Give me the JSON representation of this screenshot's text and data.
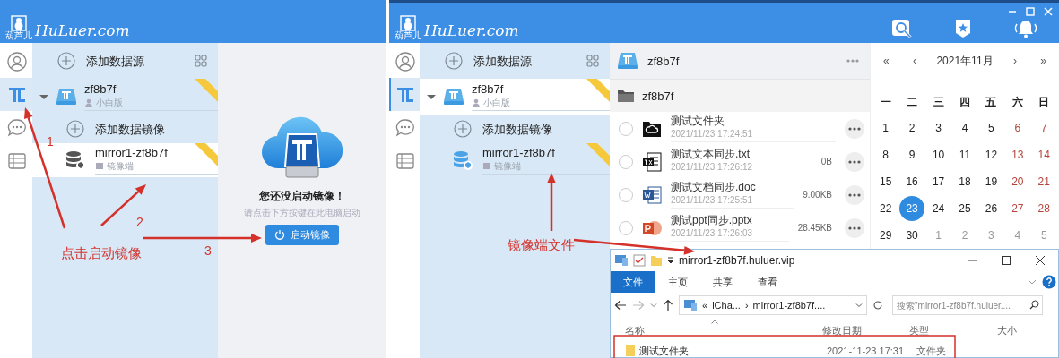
{
  "left_app": {
    "logo": {
      "text": "HuLuer.com",
      "caption": "葫芦儿"
    },
    "nav": [
      {
        "kind": "user",
        "selected": false
      },
      {
        "kind": "mirror",
        "selected": true
      },
      {
        "kind": "chat",
        "selected": false
      },
      {
        "kind": "list",
        "selected": false
      }
    ],
    "tree": {
      "add_label": "添加数据源",
      "sources": [
        {
          "name": "zf8b7f",
          "edition": "小白版",
          "expanded": true,
          "selected": false,
          "add_label": "添加数据镜像",
          "children": [
            {
              "name": "mirror1-zf8b7f",
              "role": "镜像端",
              "selected": true
            }
          ]
        }
      ]
    },
    "empty_state": {
      "title": "您还没启动镜像！",
      "hint": "请点击下方按键在此电脑启动",
      "button": "启动镜像"
    }
  },
  "right_app": {
    "logo": {
      "text": "HuLuer.com",
      "caption": "葫芦儿"
    },
    "header_icons": [
      {
        "kind": "search"
      },
      {
        "kind": "star"
      },
      {
        "kind": "bell"
      }
    ],
    "nav": [
      {
        "kind": "user",
        "selected": false
      },
      {
        "kind": "mirror",
        "selected": true
      },
      {
        "kind": "chat",
        "selected": false
      },
      {
        "kind": "list",
        "selected": false
      }
    ],
    "tree": {
      "add_label": "添加数据源",
      "sources": [
        {
          "name": "zf8b7f",
          "edition": "小白版",
          "expanded": true,
          "selected": true,
          "add_label": "添加数据镜像",
          "children": [
            {
              "name": "mirror1-zf8b7f",
              "role": "镜像端",
              "selected": false
            }
          ]
        }
      ]
    },
    "files": {
      "title": "zf8b7f",
      "folder": "zf8b7f",
      "items": [
        {
          "kind": "folder",
          "name": "测试文件夹",
          "date": "2021/11/23 17:24:51",
          "checked": false
        },
        {
          "kind": "txt",
          "name": "测试文本同步.txt",
          "date": "2021/11/23 17:26:12",
          "size": "0B",
          "checked": false
        },
        {
          "kind": "doc",
          "name": "测试文档同步.doc",
          "date": "2021/11/23 17:25:51",
          "size": "9.00KB",
          "checked": false
        },
        {
          "kind": "ppt",
          "name": "测试ppt同步.pptx",
          "date": "2021/11/23 17:26:03",
          "size": "28.45KB",
          "checked": false
        }
      ]
    },
    "calendar": {
      "nav": [
        "«",
        "‹",
        "›",
        "»"
      ],
      "title": "2021年11月",
      "weekdays": [
        "一",
        "二",
        "三",
        "四",
        "五",
        "六",
        "日"
      ],
      "weeks": [
        [
          {
            "day": "1",
            "kind": "weekday",
            "selected": false
          },
          {
            "day": "2",
            "kind": "weekday",
            "selected": false
          },
          {
            "day": "3",
            "kind": "weekday",
            "selected": false
          },
          {
            "day": "4",
            "kind": "weekday",
            "selected": false
          },
          {
            "day": "5",
            "kind": "weekday",
            "selected": false
          },
          {
            "day": "6",
            "kind": "weekend",
            "selected": false
          },
          {
            "day": "7",
            "kind": "weekend",
            "selected": false
          }
        ],
        [
          {
            "day": "8",
            "kind": "weekday",
            "selected": false
          },
          {
            "day": "9",
            "kind": "weekday",
            "selected": false
          },
          {
            "day": "10",
            "kind": "weekday",
            "selected": false
          },
          {
            "day": "11",
            "kind": "weekday",
            "selected": false
          },
          {
            "day": "12",
            "kind": "weekday",
            "selected": false
          },
          {
            "day": "13",
            "kind": "weekend",
            "selected": false
          },
          {
            "day": "14",
            "kind": "weekend",
            "selected": false
          }
        ],
        [
          {
            "day": "15",
            "kind": "weekday",
            "selected": false
          },
          {
            "day": "16",
            "kind": "weekday",
            "selected": false
          },
          {
            "day": "17",
            "kind": "weekday",
            "selected": false
          },
          {
            "day": "18",
            "kind": "weekday",
            "selected": false
          },
          {
            "day": "19",
            "kind": "weekday",
            "selected": false
          },
          {
            "day": "20",
            "kind": "weekend",
            "selected": false
          },
          {
            "day": "21",
            "kind": "weekend",
            "selected": false
          }
        ],
        [
          {
            "day": "22",
            "kind": "weekday",
            "selected": false
          },
          {
            "day": "23",
            "kind": "weekday",
            "selected": true
          },
          {
            "day": "24",
            "kind": "weekday",
            "selected": false
          },
          {
            "day": "25",
            "kind": "weekday",
            "selected": false
          },
          {
            "day": "26",
            "kind": "weekday",
            "selected": false
          },
          {
            "day": "27",
            "kind": "weekend",
            "selected": false
          },
          {
            "day": "28",
            "kind": "weekend",
            "selected": false
          }
        ],
        [
          {
            "day": "29",
            "kind": "weekday",
            "selected": false
          },
          {
            "day": "30",
            "kind": "weekday",
            "selected": false
          },
          {
            "day": "1",
            "kind": "other",
            "selected": false
          },
          {
            "day": "2",
            "kind": "other",
            "selected": false
          },
          {
            "day": "3",
            "kind": "other",
            "selected": false
          },
          {
            "day": "4",
            "kind": "other",
            "selected": false
          },
          {
            "day": "5",
            "kind": "other",
            "selected": false
          }
        ]
      ]
    }
  },
  "explorer": {
    "title": "mirror1-zf8b7f.huluer.vip",
    "ribbon_tabs": [
      {
        "label": "文件",
        "selected": true
      },
      {
        "label": "主页",
        "selected": false
      },
      {
        "label": "共享",
        "selected": false
      },
      {
        "label": "查看",
        "selected": false
      }
    ],
    "address": {
      "prefix": "«",
      "crumbs": [
        "iCha...",
        "mirror1-zf8b7f...."
      ],
      "separator": "›"
    },
    "search": {
      "placeholder": "搜索\"mirror1-zf8b7f.huluer...."
    },
    "columns": [
      "名称",
      "修改日期",
      "类型",
      "大小"
    ],
    "rows": [
      {
        "name": "测试文件夹",
        "modified": "2021-11-23 17:31",
        "type": "文件夹"
      }
    ]
  },
  "annotations": {
    "steps": [
      "1",
      "2",
      "3"
    ],
    "left_caption": "点击启动镜像",
    "right_caption": "镜像端文件"
  }
}
